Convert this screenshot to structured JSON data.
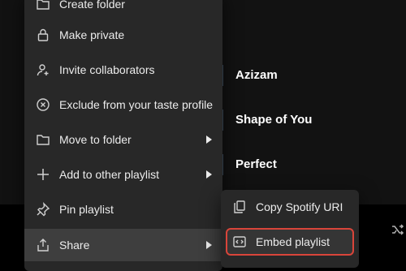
{
  "songs": [
    "Azizam",
    "Shape of You",
    "Perfect"
  ],
  "menu": {
    "items": [
      {
        "label": "Create folder",
        "icon": "folder-plus-icon"
      },
      {
        "label": "Make private",
        "icon": "lock-icon"
      },
      {
        "label": "Invite collaborators",
        "icon": "add-person-icon"
      },
      {
        "label": "Exclude from your taste profile",
        "icon": "exclude-icon"
      },
      {
        "label": "Move to folder",
        "icon": "folder-icon"
      },
      {
        "label": "Add to other playlist",
        "icon": "plus-icon"
      },
      {
        "label": "Pin playlist",
        "icon": "pin-icon"
      },
      {
        "label": "Share",
        "icon": "share-icon"
      }
    ]
  },
  "submenu": {
    "items": [
      {
        "label": "Copy Spotify URI",
        "icon": "copy-icon"
      },
      {
        "label": "Embed playlist",
        "icon": "embed-icon"
      }
    ]
  },
  "colors": {
    "menu_bg": "#282828",
    "highlight_border": "#d9453a"
  }
}
